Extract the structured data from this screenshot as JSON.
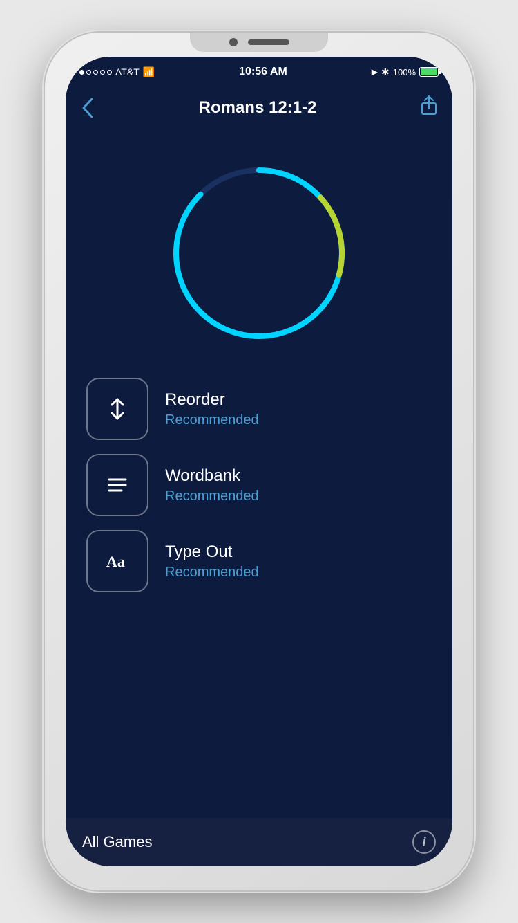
{
  "status_bar": {
    "carrier": "AT&T",
    "time": "10:56 AM",
    "battery_percent": "100%",
    "signal_dots": [
      "filled",
      "empty",
      "empty",
      "empty",
      "empty"
    ]
  },
  "nav": {
    "back_label": "‹",
    "title": "Romans 12:1-2",
    "share_icon": "share"
  },
  "circle": {
    "progress_color": "#00d4ff",
    "accent_color": "#b8d432"
  },
  "games": [
    {
      "id": "reorder",
      "title": "Reorder",
      "subtitle": "Recommended",
      "icon_type": "reorder"
    },
    {
      "id": "wordbank",
      "title": "Wordbank",
      "subtitle": "Recommended",
      "icon_type": "wordbank"
    },
    {
      "id": "typeout",
      "title": "Type Out",
      "subtitle": "Recommended",
      "icon_type": "typeout"
    }
  ],
  "bottom_bar": {
    "title": "All Games",
    "info_label": "i"
  }
}
